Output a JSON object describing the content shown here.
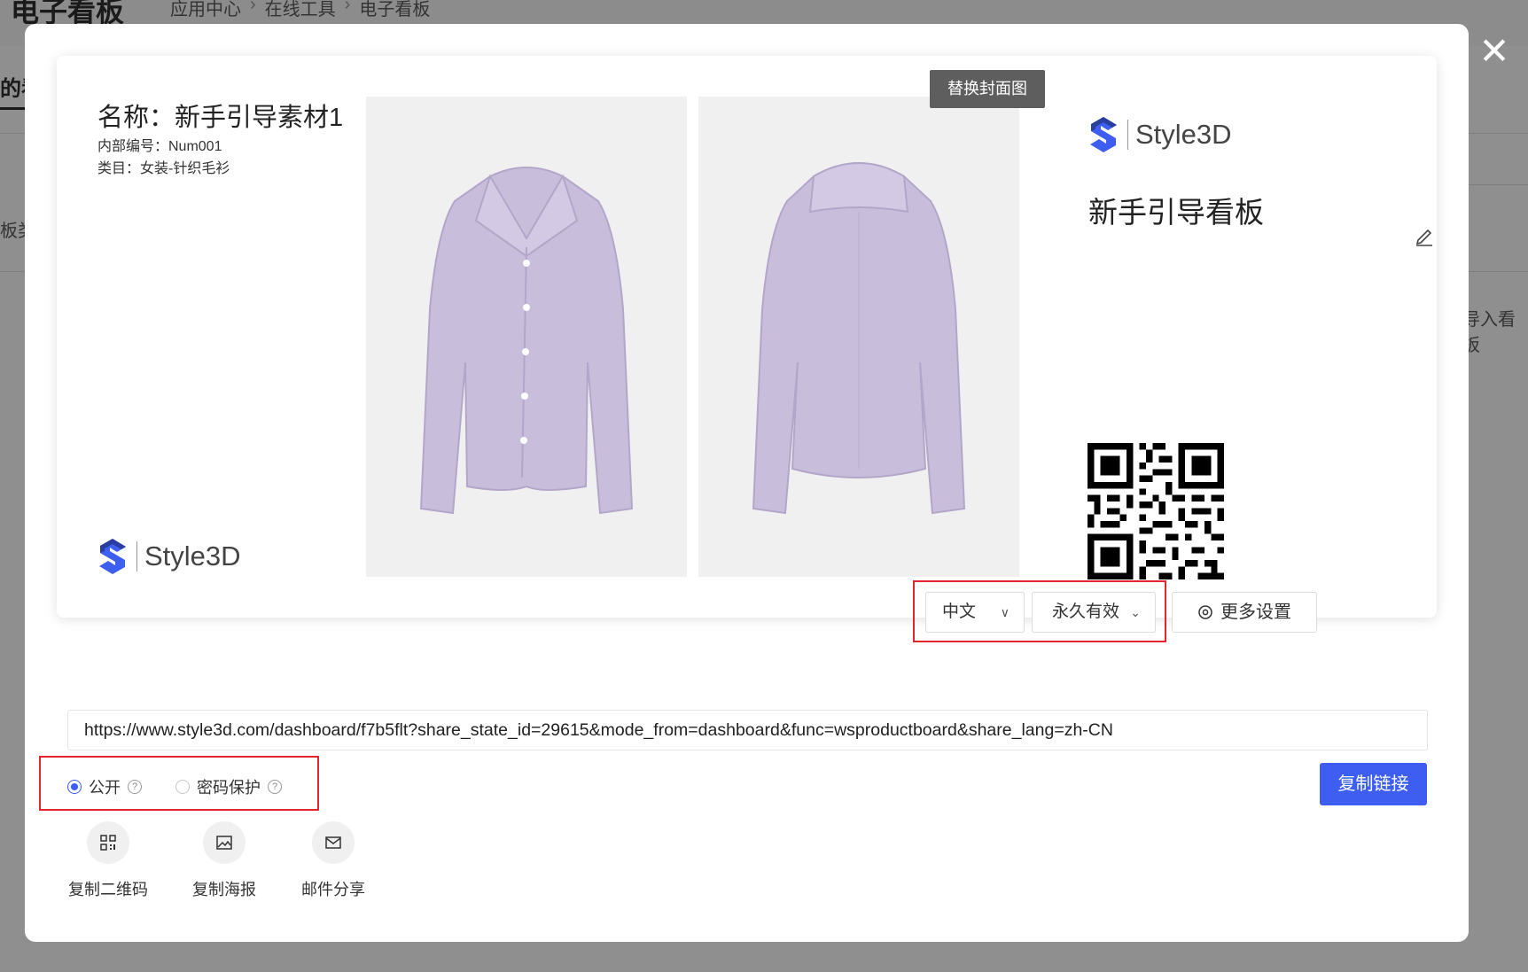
{
  "background": {
    "title": "电子看板",
    "breadcrumb": [
      "应用中心",
      "在线工具",
      "电子看板"
    ],
    "tab": "的看",
    "side_left": "板类",
    "side_right": "导入看板"
  },
  "board": {
    "name": "名称：新手引导素材1",
    "code": "内部编号：Num001",
    "category": "类目：女装-针织毛衫",
    "logo_text": "Style3D",
    "replace_cover_label": "替换封面图",
    "title": "新手引导看板"
  },
  "controls": {
    "language": "中文",
    "validity": "永久有效",
    "more_settings": "更多设置",
    "url": "https://www.style3d.com/dashboard/f7b5flt?share_state_id=29615&mode_from=dashboard&func=wsproductboard&share_lang=zh-CN",
    "visibility_public": "公开",
    "visibility_password": "密码保护",
    "copy_link": "复制链接"
  },
  "share": [
    {
      "label": "复制二维码",
      "icon": "qrcode-icon"
    },
    {
      "label": "复制海报",
      "icon": "image-icon"
    },
    {
      "label": "邮件分享",
      "icon": "mail-icon"
    }
  ],
  "colors": {
    "accent": "#3d5ef0",
    "highlight_box": "#e2262b",
    "garment": "#c9bddc"
  }
}
